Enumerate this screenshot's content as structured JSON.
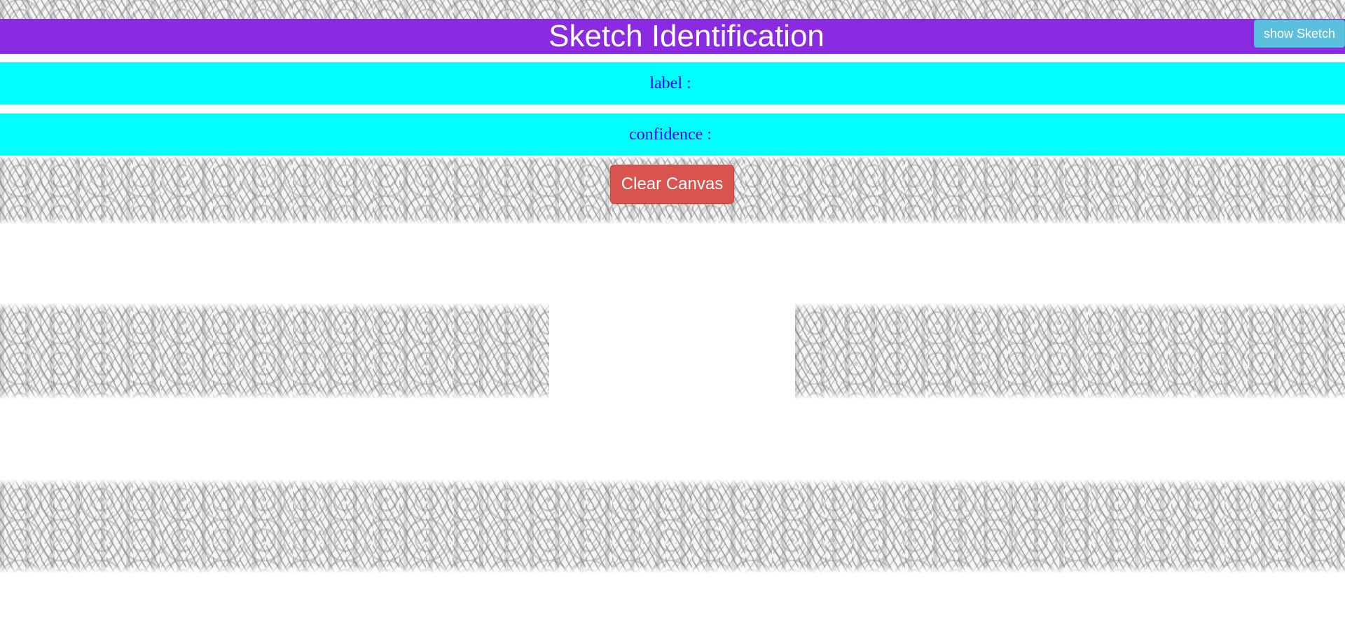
{
  "header": {
    "title": "Sketch Identification",
    "title_bg_color": "#8a2be2"
  },
  "toolbar": {
    "show_sketch_label": "show Sketch",
    "show_sketch_color": "#5bc0de"
  },
  "results": {
    "label_caption": "label :",
    "label_value": "",
    "confidence_caption": "confidence :",
    "confidence_value": "",
    "bar_color": "#00ffff",
    "text_color": "#0000ff"
  },
  "canvas_controls": {
    "clear_label": "Clear Canvas",
    "clear_color": "#d9534f"
  },
  "background": {
    "pattern": "leaf-pattern"
  }
}
